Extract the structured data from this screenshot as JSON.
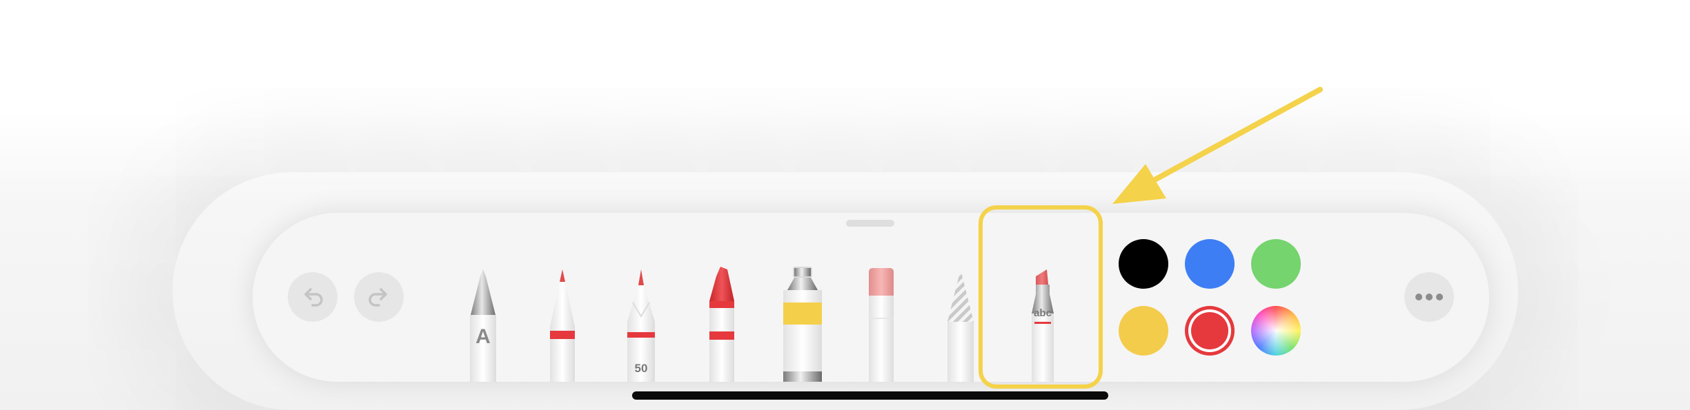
{
  "toolbar": {
    "undo_icon": "undo-arrow-icon",
    "redo_icon": "redo-arrow-icon",
    "more_icon": "ellipsis-icon",
    "tools": [
      {
        "name": "pen",
        "label": "A"
      },
      {
        "name": "marker",
        "label": ""
      },
      {
        "name": "pencil",
        "label": "50"
      },
      {
        "name": "crayon",
        "label": ""
      },
      {
        "name": "paint-tube",
        "label": ""
      },
      {
        "name": "eraser",
        "label": ""
      },
      {
        "name": "lasso",
        "label": ""
      },
      {
        "name": "handwriting-pencil",
        "label": "abc",
        "selected": true
      }
    ],
    "colors": [
      "#000000",
      "#3d7ef5",
      "#75d46e",
      "#f4cc4c",
      "#e5393d",
      "color-wheel"
    ],
    "selected_color": "#e5393d"
  },
  "annotation": {
    "highlight_color": "#f4d24a",
    "arrow_color": "#f4d24a"
  }
}
